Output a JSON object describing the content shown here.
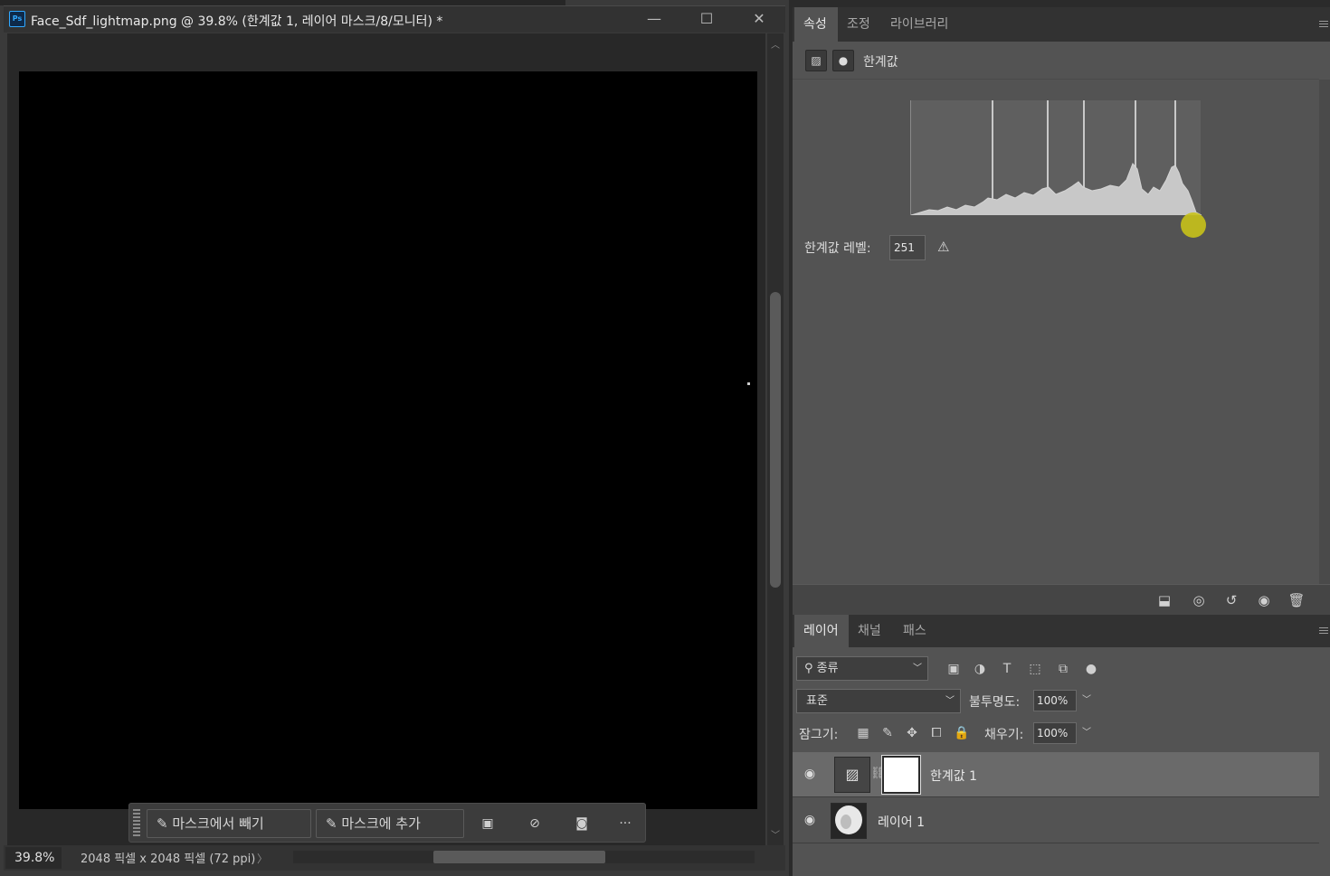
{
  "document": {
    "app_badge": "Ps",
    "title": "Face_Sdf_lightmap.png @ 39.8% (한계값 1, 레이어 마스크/8/모니터) *",
    "window_controls": [
      "—",
      "☐",
      "✕"
    ],
    "zoom": "39.8%",
    "doc_size": "2048 픽셀 x 2048 픽셀 (72 ppi)",
    "status_arrow": "〉"
  },
  "context_bar": {
    "subtract_label": "마스크에서 빼기",
    "add_label": "마스크에 추가",
    "more": "···"
  },
  "properties": {
    "tabs": [
      "속성",
      "조정",
      "라이브러리"
    ],
    "active_tab": "속성",
    "adjustment_name": "한계값",
    "threshold_label": "한계값 레벨:",
    "threshold_value": "251"
  },
  "layers_panel": {
    "tabs": [
      "레이어",
      "채널",
      "패스"
    ],
    "active_tab": "레이어",
    "filter_kind": "종류",
    "blend_mode": "표준",
    "opacity_label": "불투명도:",
    "opacity_value": "100%",
    "lock_label": "잠그기:",
    "fill_label": "채우기:",
    "fill_value": "100%",
    "layers": [
      {
        "name": "한계값 1",
        "selected": true,
        "visible": true
      },
      {
        "name": "레이어 1",
        "selected": false,
        "visible": true
      }
    ]
  },
  "colors": {
    "accent_slider": "#c8c21a",
    "canvas": "#000000",
    "panel_bg": "#535353"
  }
}
